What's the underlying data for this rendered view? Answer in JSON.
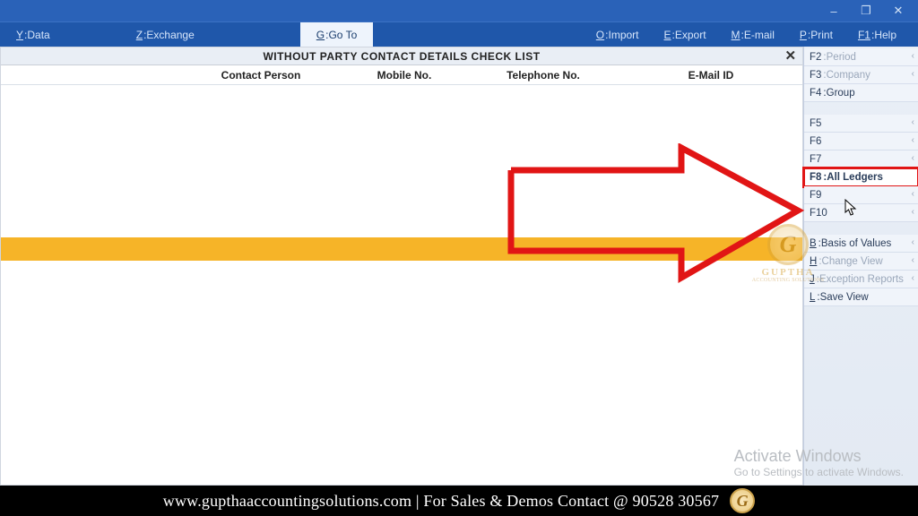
{
  "window": {
    "minimize": "–",
    "maximize": "❐",
    "close": "✕"
  },
  "menu": {
    "data": {
      "key": "Y",
      "label": "Data"
    },
    "exchange": {
      "key": "Z",
      "label": "Exchange"
    },
    "goto": {
      "key": "G",
      "label": "Go To"
    },
    "import": {
      "key": "O",
      "label": "Import"
    },
    "export": {
      "key": "E",
      "label": "Export"
    },
    "email": {
      "key": "M",
      "label": "E-mail"
    },
    "print": {
      "key": "P",
      "label": "Print"
    },
    "help": {
      "key": "F1",
      "label": "Help"
    }
  },
  "report": {
    "title": "WITHOUT PARTY CONTACT DETAILS CHECK LIST",
    "close": "✕"
  },
  "columns": {
    "contact": "Contact Person",
    "mobile": "Mobile No.",
    "tel": "Telephone No.",
    "email": "E-Mail ID"
  },
  "sidebar": {
    "f2": {
      "key": "F2",
      "label": "Period"
    },
    "f3": {
      "key": "F3",
      "label": "Company"
    },
    "f4": {
      "key": "F4",
      "label": "Group"
    },
    "f5": {
      "key": "F5",
      "label": ""
    },
    "f6": {
      "key": "F6",
      "label": ""
    },
    "f7": {
      "key": "F7",
      "label": ""
    },
    "f8": {
      "key": "F8",
      "label": "All Ledgers"
    },
    "f9": {
      "key": "F9",
      "label": ""
    },
    "f10": {
      "key": "F10",
      "label": ""
    },
    "b": {
      "key": "B",
      "label": "Basis of Values"
    },
    "h": {
      "key": "H",
      "label": "Change View"
    },
    "j": {
      "key": "J",
      "label": "Exception Reports"
    },
    "l": {
      "key": "L",
      "label": "Save View"
    }
  },
  "watermark": {
    "logo_initial": "G",
    "logo_name": "GUPTHA",
    "logo_tag": "ACCOUNTING SOLUTIONS"
  },
  "activate": {
    "line1": "Activate Windows",
    "line2": "Go to Settings to activate Windows."
  },
  "footer": {
    "text": "www.gupthaaccountingsolutions.com | For Sales & Demos Contact @ 90528 30567",
    "logo_initial": "G"
  }
}
